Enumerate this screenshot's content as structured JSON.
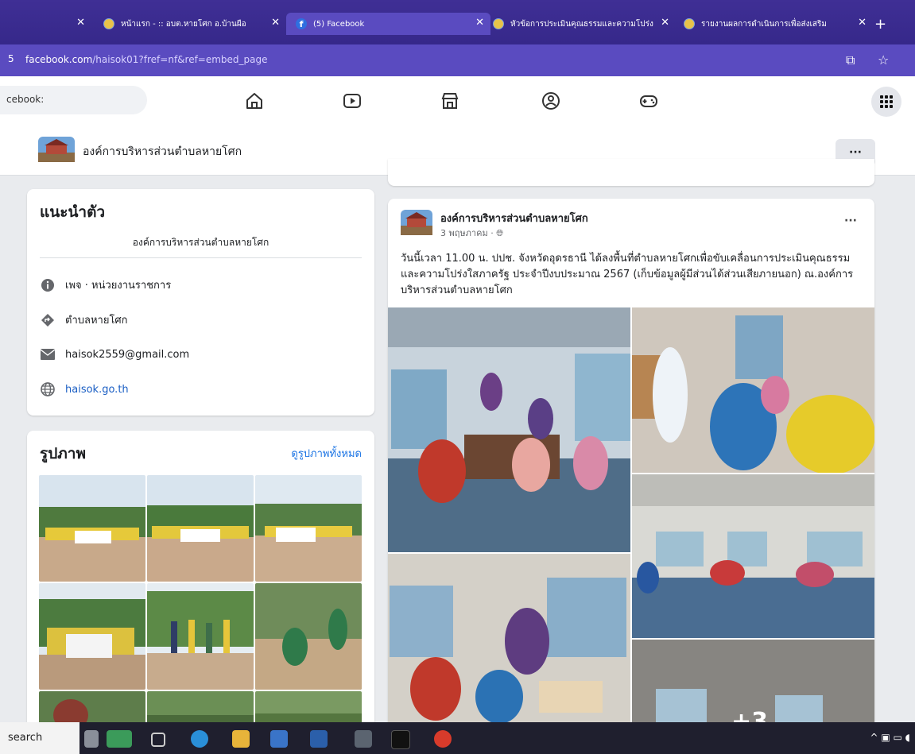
{
  "browser": {
    "tabs": [
      {
        "title": "หน้าแรก - :: อบต.หายโศก อ.บ้านผือ",
        "active": false
      },
      {
        "title": "(5) Facebook",
        "active": true
      },
      {
        "title": "หัวข้อการประเมินคุณธรรมและความโปร่ง",
        "active": false
      },
      {
        "title": "รายงานผลการดำเนินการเพื่อส่งเสริม",
        "active": false
      }
    ],
    "url_host": "facebook.com",
    "url_path": "/haisok01?fref=nf&ref=embed_page",
    "url_prefix": "5"
  },
  "fbnav": {
    "search_text": "cebook:"
  },
  "page": {
    "name": "องค์การบริหารส่วนตำบลหายโศก",
    "more_label": "···"
  },
  "intro": {
    "heading": "แนะนำตัว",
    "description": "องค์การบริหารส่วนตำบลหายโศก",
    "category": "เพจ · หน่วยงานราชการ",
    "location": "ตำบลหายโศก",
    "email": "haisok2559@gmail.com",
    "website": "haisok.go.th"
  },
  "photos": {
    "heading": "รูปภาพ",
    "see_all": "ดูรูปภาพทั้งหมด"
  },
  "post": {
    "author": "องค์การบริหารส่วนตำบลหายโศก",
    "date": "3 พฤษภาคม ·",
    "more_label": "···",
    "text": "วันนี้เวลา 11.00 น. ปปช. จังหวัดอุดรธานี ได้ลงพื้นที่ตำบลหายโศกเพื่อขับเคลื่อนการประเมินคุณธรรมและความโปร่งใสภาครัฐ ประจำปีงบประมาณ 2567 (เก็บข้อมูลผู้มีส่วนได้ส่วนเสียภายนอก) ณ.องค์การบริหารส่วนตำบลหายโศก",
    "more_photos": "+3"
  },
  "taskbar": {
    "search_label": "search"
  },
  "colors": {
    "tabbar": "#3a2a8a",
    "addrbar": "#5a4bc0",
    "link": "#1b74e4"
  }
}
